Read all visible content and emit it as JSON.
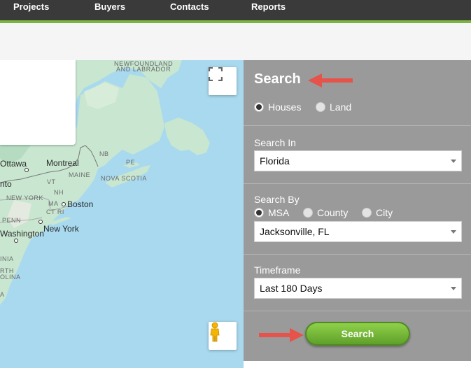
{
  "nav": {
    "items": [
      {
        "label": "Projects"
      },
      {
        "label": "Buyers"
      },
      {
        "label": "Contacts"
      },
      {
        "label": "Reports"
      }
    ]
  },
  "map": {
    "labels": {
      "newfoundland_1": "NEWFOUNDLAND",
      "newfoundland_2": "AND LABRADOR",
      "nb": "NB",
      "pe": "PE",
      "nova_scotia": "NOVA SCOTIA",
      "ottawa": "Ottawa",
      "montreal": "Montreal",
      "maine": "MAINE",
      "vt": "VT",
      "nh": "NH",
      "toronto_partial": "nto",
      "new_york_state": "NEW YORK",
      "ma": "MA",
      "boston": "Boston",
      "ct_ri": "CT RI",
      "penn": "PENN",
      "new_york": "New York",
      "washington": "Washington",
      "virginia_partial": "INIA",
      "north_partial": "RTH",
      "carolina_partial": "OLINA",
      "sc_partial": "A"
    },
    "icons": {
      "fullscreen": "fullscreen-icon",
      "pegman": "street-view-pegman-icon"
    }
  },
  "search": {
    "title": "Search",
    "property_types": [
      {
        "label": "Houses",
        "selected": true
      },
      {
        "label": "Land",
        "selected": false
      }
    ],
    "search_in": {
      "label": "Search In",
      "value": "Florida"
    },
    "search_by": {
      "label": "Search By",
      "options": [
        {
          "label": "MSA",
          "selected": true
        },
        {
          "label": "County",
          "selected": false
        },
        {
          "label": "City",
          "selected": false
        }
      ],
      "value": "Jacksonville, FL"
    },
    "timeframe": {
      "label": "Timeframe",
      "value": "Last 180 Days"
    },
    "button_label": "Search"
  },
  "colors": {
    "nav_bg": "#3a3a3a",
    "accent_green": "#7cb342",
    "panel_bg": "#9a9a9a",
    "button_green": "#6fb536",
    "annotation_arrow": "#e5534b",
    "water": "#a8d9ee",
    "land": "#c8e6d0"
  }
}
